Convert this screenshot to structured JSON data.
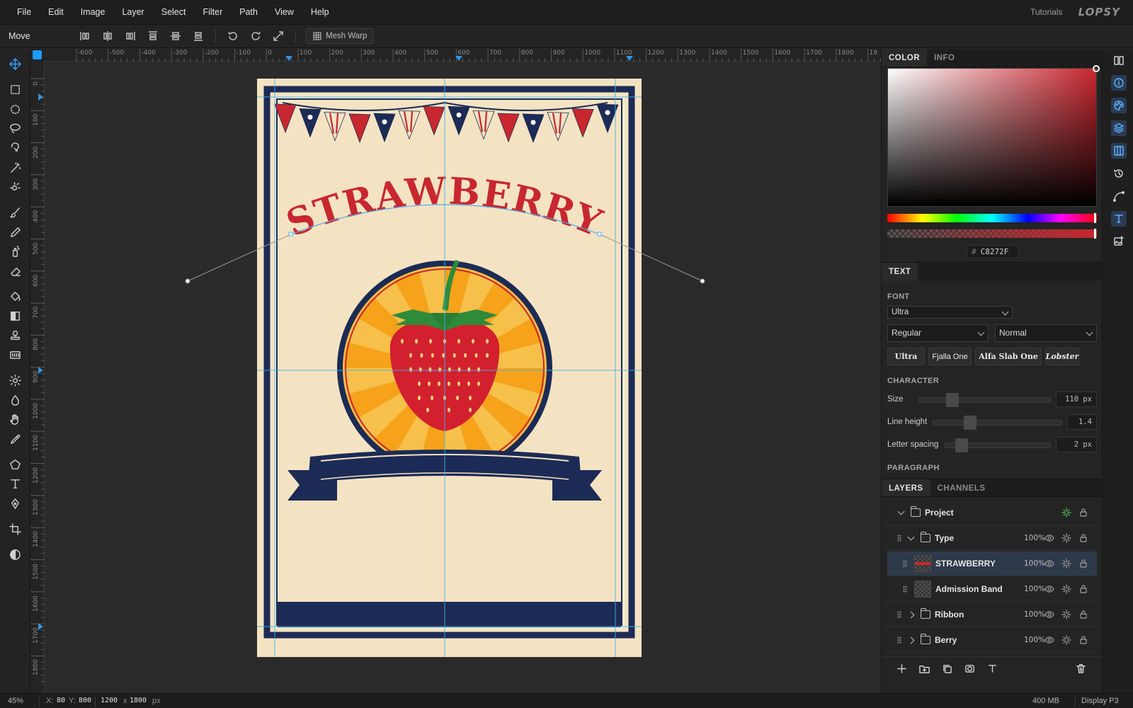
{
  "menu": {
    "items": [
      "File",
      "Edit",
      "Image",
      "Layer",
      "Select",
      "Filter",
      "Path",
      "View",
      "Help"
    ],
    "tutorials": "Tutorials",
    "brand": "LOPSY"
  },
  "options_bar": {
    "tool_name": "Move",
    "mesh_warp_label": "Mesh Warp"
  },
  "rulers": {
    "horizontal_ticks": [
      "-600",
      "-500",
      "-400",
      "-300",
      "-200",
      "-100",
      "0",
      "100",
      "200",
      "300",
      "400",
      "500",
      "600",
      "700",
      "800",
      "900",
      "1000",
      "1100",
      "1200",
      "1300",
      "1400",
      "1500",
      "1600",
      "1700",
      "1800",
      "19"
    ],
    "vertical_ticks": [
      "0",
      "100",
      "200",
      "300",
      "400",
      "500",
      "600",
      "700",
      "800",
      "900",
      "1000",
      "1100",
      "1200",
      "1300",
      "1400",
      "1500",
      "1600",
      "1700",
      "1800"
    ]
  },
  "poster": {
    "title": "STRAWBERRY",
    "colors": {
      "background": "#f4e3c3",
      "navy": "#1c2b55",
      "red": "#c8272f",
      "orange": "#f6a21b",
      "green": "#2e8b3a"
    }
  },
  "color_panel": {
    "tabs": [
      "COLOR",
      "INFO"
    ],
    "active_tab": "COLOR",
    "hex_prefix": "#",
    "hex": "C8272F"
  },
  "text_panel": {
    "tab": "TEXT",
    "font_label": "FONT",
    "font_value": "Ultra",
    "style_value": "Regular",
    "weight_value": "Normal",
    "font_chips": [
      "Ultra",
      "Fjalla One",
      "Alfa Slab One",
      "Lobster"
    ],
    "character_label": "CHARACTER",
    "size_label": "Size",
    "size_value": "110 px",
    "line_height_label": "Line height",
    "line_height_value": "1.4",
    "letter_spacing_label": "Letter spacing",
    "letter_spacing_value": "2 px",
    "paragraph_label": "PARAGRAPH"
  },
  "layers_panel": {
    "tabs": [
      "LAYERS",
      "CHANNELS"
    ],
    "active_tab": "LAYERS",
    "rows": [
      {
        "name": "Project",
        "type": "group",
        "opacity": ""
      },
      {
        "name": "Type",
        "type": "group",
        "opacity": "100%"
      },
      {
        "name": "STRAWBERRY",
        "type": "layer",
        "opacity": "100%",
        "selected": true
      },
      {
        "name": "Admission Band",
        "type": "layer",
        "opacity": "100%"
      },
      {
        "name": "Ribbon",
        "type": "group",
        "opacity": "100%"
      },
      {
        "name": "Berry",
        "type": "group",
        "opacity": "100%"
      }
    ]
  },
  "status_bar": {
    "zoom": "45%",
    "cursor_x_label": "X:",
    "cursor_x": "80",
    "cursor_y_label": "Y:",
    "cursor_y": "800",
    "doc_w": "1200",
    "doc_x": "x",
    "doc_h": "1800",
    "doc_unit": "px",
    "memory": "400 MB",
    "color_profile": "Display P3"
  }
}
